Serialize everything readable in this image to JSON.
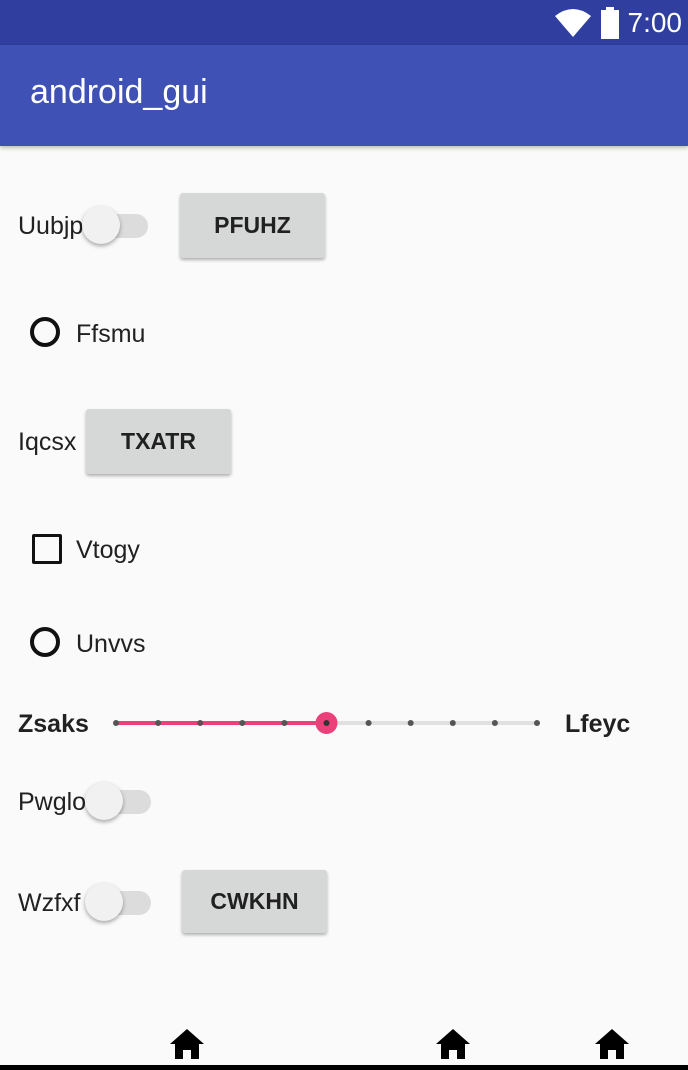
{
  "status_bar": {
    "time": "7:00",
    "icons": [
      "wifi-icon",
      "battery-icon"
    ]
  },
  "app_bar": {
    "title": "android_gui",
    "color": "#3f51b5"
  },
  "rows": {
    "r1": {
      "label": "Uubjp",
      "switch_on": false,
      "button": "PFUHZ"
    },
    "r2": {
      "label": "Ffsmu",
      "checked": false
    },
    "r3": {
      "label": "Iqcsx",
      "button": "TXATR"
    },
    "r4": {
      "label": "Vtogy",
      "checked": false
    },
    "r5": {
      "label": "Unvvs",
      "checked": false
    },
    "r6": {
      "left_label": "Zsaks",
      "right_label": "Lfeyc",
      "steps": 10,
      "value": 5,
      "accent": "#ec407a"
    },
    "r7": {
      "label": "Pwglo",
      "switch_on": false
    },
    "r8": {
      "label": "Wzfxf",
      "switch_on": false,
      "button": "CWKHN"
    }
  },
  "nav_bar": {
    "icons": [
      "home-icon",
      "home-icon",
      "home-icon"
    ]
  }
}
